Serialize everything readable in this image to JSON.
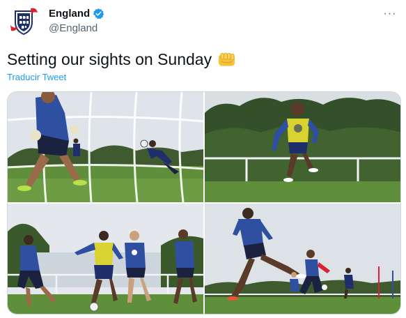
{
  "tweet": {
    "author": {
      "display_name": "England",
      "handle": "@England",
      "verified": true,
      "avatar_icon": "england-crest-icon"
    },
    "text": "Setting our sights on Sunday",
    "emoji": "oncoming-fist-icon",
    "translate_label": "Traducir Tweet",
    "more_label": "···"
  },
  "colors": {
    "link": "#1d9bf0",
    "text": "#0f1419",
    "secondary": "#536471",
    "border": "#cfd9de",
    "kit_navy": "#1e2f6b",
    "bib_yellow": "#d8d330",
    "pitch_green": "#5f8f3a"
  }
}
